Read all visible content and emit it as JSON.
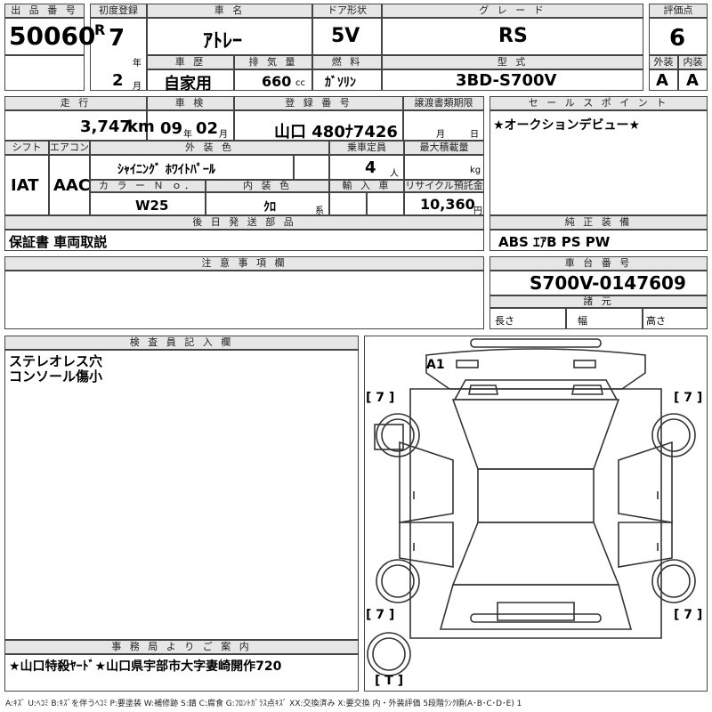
{
  "headers": {
    "lot_no": "出 品 番 号",
    "first_reg": "初度登録",
    "car_name": "車 名",
    "door": "ドア形状",
    "grade": "グ レ ー ド",
    "score": "評価点",
    "history": "車 歴",
    "displacement": "排 気 量",
    "fuel": "燃 料",
    "model": "型 式",
    "exterior": "外装",
    "interior": "内装",
    "mileage": "走 行",
    "inspection": "車 検",
    "reg_no": "登 録 番 号",
    "transfer": "譲渡書類期限",
    "sales_point": "セ ー ル ス ポ イ ン ト",
    "shift": "シフト",
    "aircon": "エアコン",
    "ext_color": "外 装 色",
    "capacity": "乗車定員",
    "max_load": "最大積載量",
    "color_no": "カ ラ ー Ｎ ｏ．",
    "int_color": "内 装 色",
    "import": "輸 入 車",
    "recycle": "リサイクル預託金",
    "later_parts": "後 日 発 送 部 品",
    "equipment": "純 正 装 備",
    "notes": "注 意 事 項 欄",
    "chassis_no": "車 台 番 号",
    "specs": "諸 元",
    "inspector": "検 査 員 記 入 欄",
    "office": "事 務 局 よ り ご 案 内"
  },
  "units": {
    "year": "年",
    "month": "月",
    "cc": "cc",
    "km": "km",
    "people": "人",
    "kg": "kg",
    "yen": "円",
    "system": "系",
    "length": "長さ",
    "width": "幅",
    "height": "高さ"
  },
  "vehicle": {
    "lot_no": "50060",
    "era": "R",
    "first_reg_year": "7",
    "first_reg_month": "2",
    "car_name": "ｱﾄﾚｰ",
    "door": "5V",
    "grade": "RS",
    "score": "6",
    "history": "自家用",
    "displacement": "660",
    "fuel": "ｶﾞｿﾘﾝ",
    "model": "3BD-S700V",
    "exterior_grade": "A",
    "interior_grade": "A",
    "mileage": "3,747",
    "inspection_year": "09",
    "inspection_month": "02",
    "reg_no": "山口 480ﾅ7426",
    "transfer_month": "月",
    "transfer_day": "日",
    "sales_point": "★オークションデビュー★",
    "shift": "IAT",
    "aircon": "AAC",
    "ext_color": "ｼｬｲﾆﾝｸﾞ ﾎﾜｲﾄﾊﾟｰﾙ",
    "capacity": "4",
    "color_no": "W25",
    "int_color": "ｸﾛ",
    "recycle": "10,360",
    "later_parts": "保証書 車両取説",
    "equipment": "ABS ｴｱB PS PW",
    "chassis_no": "S700V-0147609",
    "inspector_notes": [
      "ステレオレス穴",
      "コンソール傷小"
    ],
    "office_notes": "★山口特殺ﾔｰﾄﾞ★山口県宇部市大字妻崎開作720"
  },
  "diagram": {
    "tire_marks": [
      "[ 7 ]",
      "[ 7 ]",
      "[ 7 ]",
      "[ 7 ]",
      "[ T ]"
    ],
    "damage_marks": [
      "A1"
    ]
  },
  "legend": "A:ｷｽﾞ U:ﾍｺﾐ B:ｷｽﾞを伴うﾍｺﾐ P:要塗装 W:補修跡 S:錆 C:腐食 G:ﾌﾛﾝﾄｶﾞﾗｽ点ｷｽﾞ XX:交換済み X:要交換 内・外装評価 5段階ﾗﾝｸ順(A･B･C･D･E) 1"
}
